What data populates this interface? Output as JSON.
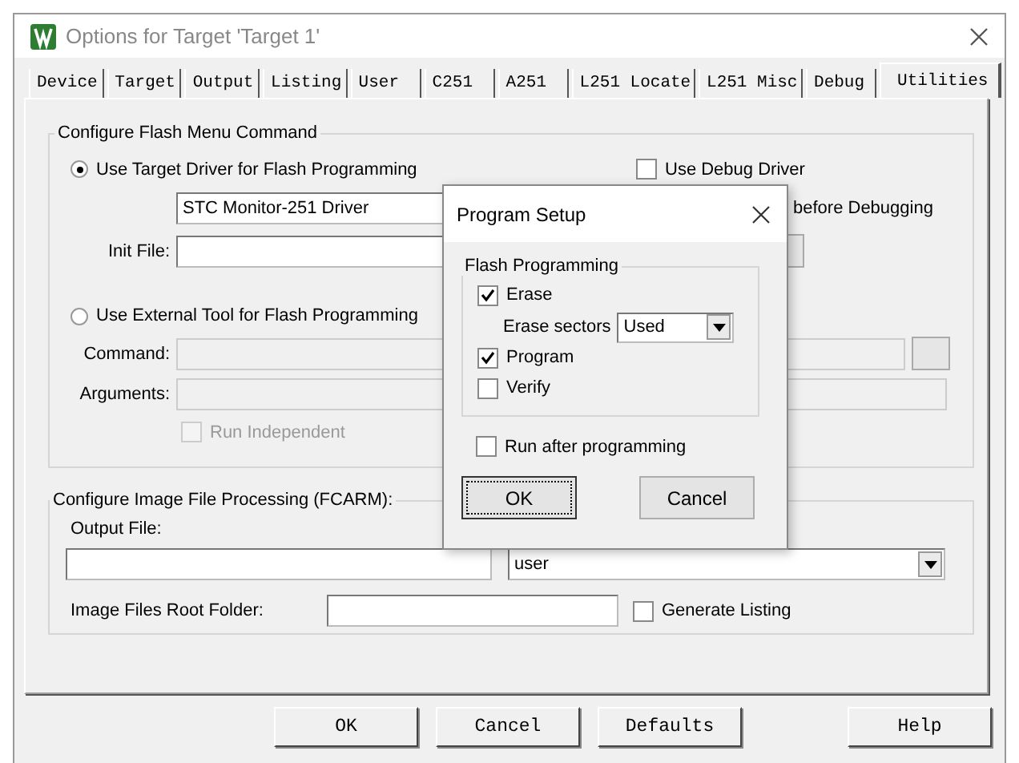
{
  "window": {
    "title": "Options for Target 'Target 1'"
  },
  "tabs": [
    {
      "label": "Device",
      "selected": false
    },
    {
      "label": "Target",
      "selected": false
    },
    {
      "label": "Output",
      "selected": false
    },
    {
      "label": "Listing",
      "selected": false
    },
    {
      "label": "User",
      "selected": false
    },
    {
      "label": "C251",
      "selected": false
    },
    {
      "label": "A251",
      "selected": false
    },
    {
      "label": "L251 Locate",
      "selected": false
    },
    {
      "label": "L251 Misc",
      "selected": false
    },
    {
      "label": "Debug",
      "selected": false
    },
    {
      "label": "Utilities",
      "selected": true
    }
  ],
  "flash_menu": {
    "title": "Configure Flash Menu Command",
    "use_target_driver": {
      "label": "Use Target Driver for Flash Programming",
      "selected": true
    },
    "use_debug_driver": {
      "label": "Use Debug Driver",
      "checked": false
    },
    "driver_select": {
      "value": "STC Monitor-251 Driver"
    },
    "update_target": {
      "label": "before Debugging"
    },
    "init_file": {
      "label": "Init File:"
    },
    "use_external_tool": {
      "label": "Use External Tool for Flash Programming",
      "selected": false
    },
    "command": {
      "label": "Command:"
    },
    "arguments": {
      "label": "Arguments:"
    },
    "run_independent": {
      "label": "Run Independent",
      "checked": false,
      "disabled": true
    }
  },
  "image_processing": {
    "title": "Configure Image File Processing (FCARM):",
    "output_file": {
      "label": "Output File:"
    },
    "select": {
      "value": "user"
    },
    "root_folder": {
      "label": "Image Files Root Folder:"
    },
    "generate_listing": {
      "label": "Generate Listing",
      "checked": false
    }
  },
  "buttons": [
    {
      "label": "OK"
    },
    {
      "label": "Cancel"
    },
    {
      "label": "Defaults"
    },
    {
      "label": "Help"
    }
  ],
  "program_setup": {
    "title": "Program Setup",
    "group_title": "Flash Programming",
    "options": [
      {
        "kind": "checkbox",
        "label": "Erase",
        "checked": true
      },
      {
        "kind": "select",
        "label": "Erase sectors",
        "value": "Used"
      },
      {
        "kind": "checkbox",
        "label": "Program",
        "checked": true
      },
      {
        "kind": "checkbox",
        "label": "Verify",
        "checked": false
      }
    ],
    "run_after": {
      "label": "Run after programming",
      "checked": false
    },
    "buttons": [
      {
        "label": "OK",
        "focused": true
      },
      {
        "label": "Cancel",
        "focused": false
      }
    ]
  }
}
